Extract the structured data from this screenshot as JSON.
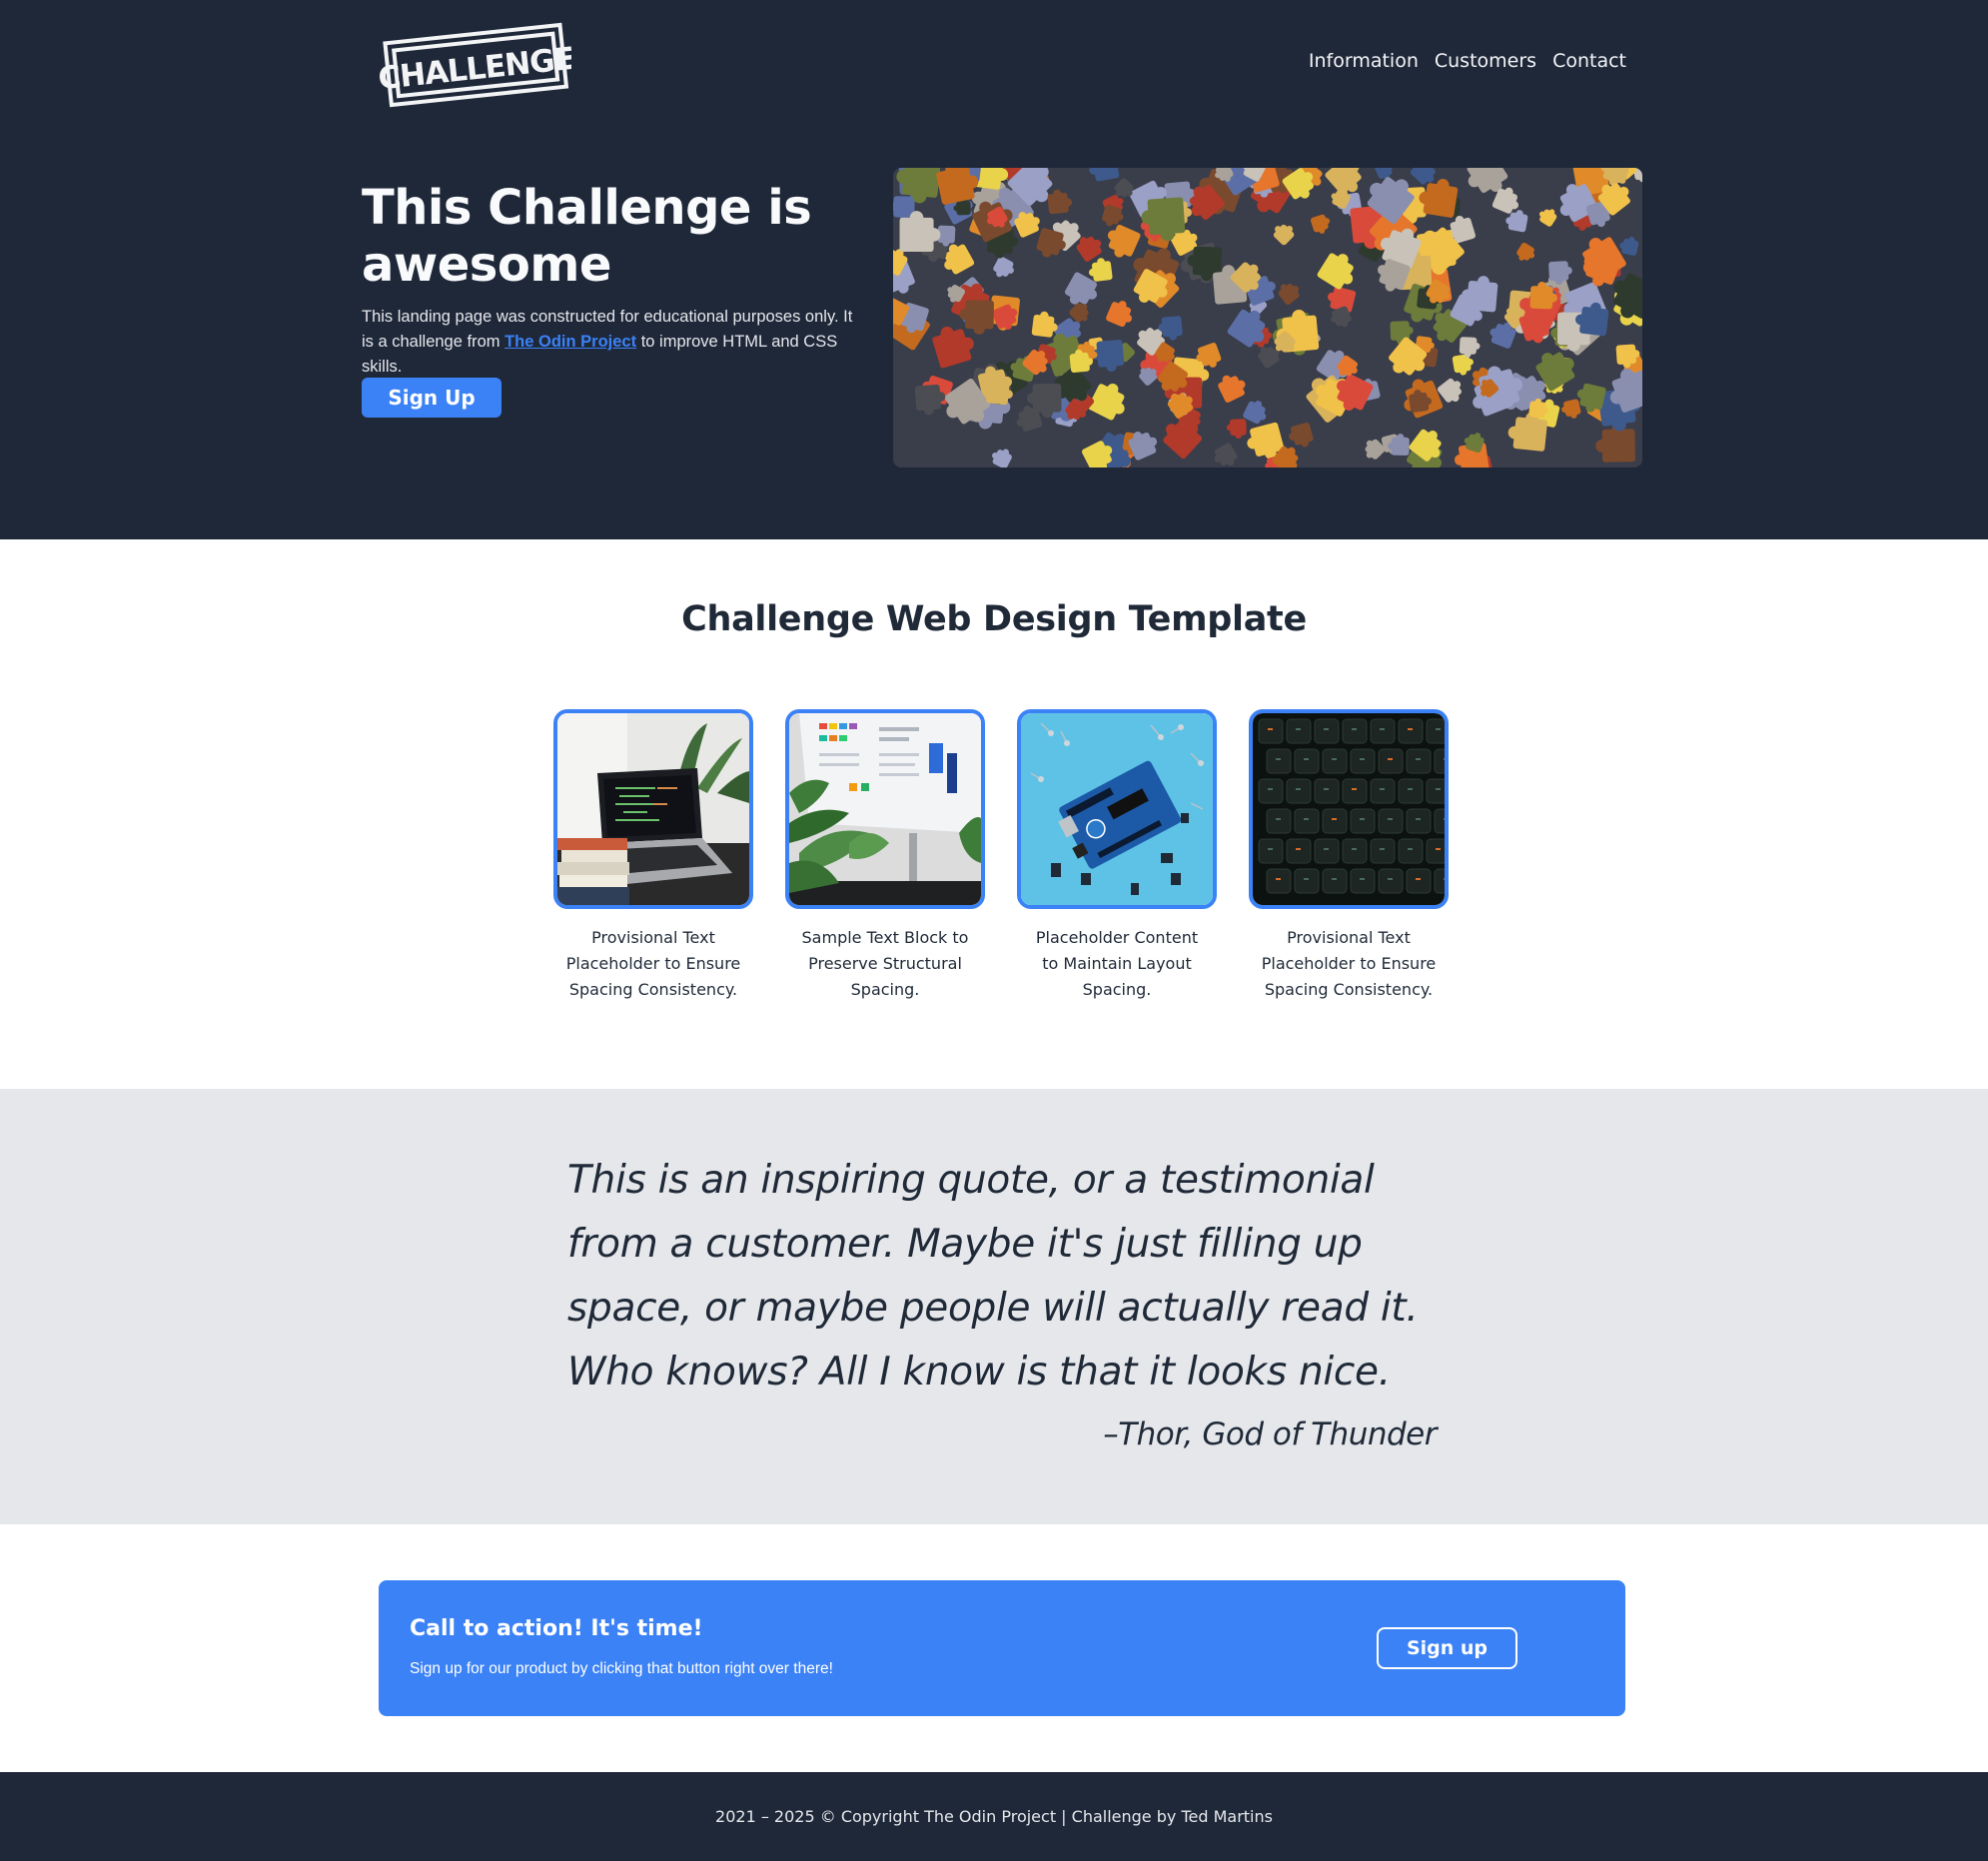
{
  "header": {
    "logo_text": "CHALLENGE",
    "nav": [
      {
        "label": "Information"
      },
      {
        "label": "Customers"
      },
      {
        "label": "Contact"
      }
    ]
  },
  "hero": {
    "title": "This Challenge is awesome",
    "text_before": "This landing page was constructed for educational purposes only. It is a challenge from ",
    "link_text": "The Odin Project",
    "text_after": " to improve HTML and CSS skills.",
    "button_label": "Sign Up",
    "image_alt": "jigsaw-puzzle-pieces-image"
  },
  "info": {
    "heading": "Challenge Web Design Template",
    "cards": [
      {
        "text": "Provisional Text Placeholder to Ensure Spacing Consistency.",
        "image": "laptop-with-books-image"
      },
      {
        "text": "Sample Text Block to Preserve Structural Spacing.",
        "image": "desktop-monitor-with-plants-image"
      },
      {
        "text": "Placeholder Content to Maintain Layout Spacing.",
        "image": "arduino-board-image"
      },
      {
        "text": "Provisional Text Placeholder to Ensure Spacing Consistency.",
        "image": "keyboard-image"
      }
    ]
  },
  "quote": {
    "text": "This is an inspiring quote, or a testimonial from a customer. Maybe it's just filling up space, or maybe people will actually read it. Who knows? All I know is that it looks nice.",
    "author": "–Thor, God of Thunder"
  },
  "cta": {
    "title": "Call to action! It's time!",
    "text": "Sign up for our product by clicking that button right over there!",
    "button_label": "Sign up"
  },
  "footer": {
    "text": "2021 – 2025 © Copyright The Odin Project | Challenge by Ted Martins"
  },
  "colors": {
    "dark": "#1f2839",
    "accent": "#3b82f6",
    "light_gray": "#e5e7eb"
  }
}
